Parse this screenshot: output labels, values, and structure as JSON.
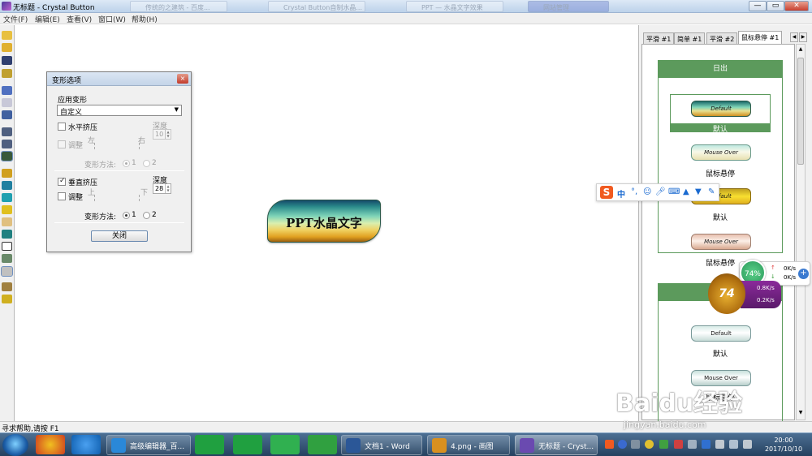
{
  "window": {
    "title": "无标题 - Crystal Button",
    "controls": [
      "—",
      "▭",
      "✕"
    ]
  },
  "ghost_tabs": [
    "传统的之建筑 - 百度...",
    "Crystal Button自制水晶...",
    "PPT — 水晶文字效果",
    "网站管理"
  ],
  "menu": [
    "文件(F)",
    "编辑(E)",
    "查看(V)",
    "窗口(W)",
    "帮助(H)"
  ],
  "dialog": {
    "title": "变形选项",
    "close": "×",
    "apply_label": "应用变形",
    "apply_value": "自定义",
    "h_squeeze": "水平挤压",
    "adjust": "调整",
    "left": "左",
    "right": "右",
    "depth": "深度",
    "h_depth": "10",
    "method": "变形方法:",
    "opt1": "1",
    "opt2": "2",
    "v_squeeze": "垂直挤压",
    "up": "上",
    "down": "下",
    "v_depth": "28",
    "close_button": "关闭"
  },
  "canvas_button": {
    "text": "PPT水晶文字"
  },
  "panel": {
    "tabs": [
      "平滑 #1",
      "简单 #1",
      "平滑 #2",
      "鼠标悬停 #1"
    ],
    "section1": {
      "header": "日出",
      "items": [
        {
          "btn": "Default",
          "label": "默认"
        },
        {
          "btn": "Mouse Over",
          "label": "鼠标悬停"
        },
        {
          "btn": "Default",
          "label": "默认"
        },
        {
          "btn": "Mouse Over",
          "label": "鼠标悬停"
        }
      ]
    },
    "section2": {
      "items": [
        {
          "btn": "Default",
          "label": "默认"
        },
        {
          "btn": "Mouse Over",
          "label": "鼠标悬停"
        }
      ]
    }
  },
  "ime": {
    "logo": "S",
    "lang": "中"
  },
  "netmon": {
    "percent": "74%",
    "up": "0K/s",
    "down": "0K/s"
  },
  "cat": {
    "percent": "74",
    "up": "0.8K/s",
    "down": "0.2K/s"
  },
  "statusbar": {
    "text": "寻求帮助,请按 F1"
  },
  "taskbar": {
    "items": [
      {
        "label": "高级编辑器_百...",
        "color": "#2a88d8"
      },
      {
        "label": "文档1 - Word",
        "color": "#2b5797"
      },
      {
        "label": "4.png - 画图",
        "color": "#d89020"
      },
      {
        "label": "无标题 - Cryst...",
        "color": "#6a4ab0"
      }
    ],
    "time": "20:00",
    "date": "2017/10/10"
  },
  "watermark": {
    "text": "Baidu经验",
    "url": "jingyan.baidu.com"
  }
}
